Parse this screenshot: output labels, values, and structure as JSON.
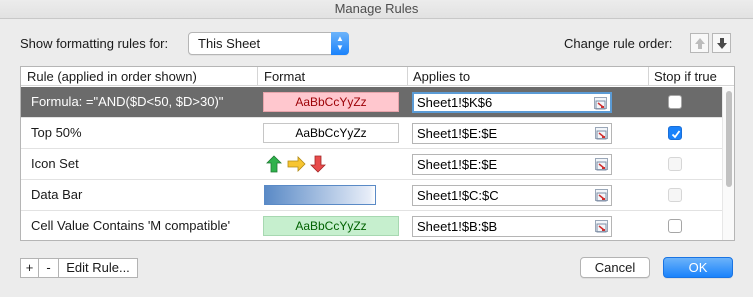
{
  "window": {
    "title": "Manage Rules"
  },
  "header": {
    "show_label": "Show formatting rules for:",
    "scope_value": "This Sheet",
    "order_label": "Change rule order:"
  },
  "table": {
    "columns": [
      "Rule (applied in order shown)",
      "Format",
      "Applies to",
      "Stop if true"
    ],
    "rows": [
      {
        "rule": "Formula: =\"AND($D<50, $D>30)\"",
        "format_type": "text-pink",
        "format_sample": "AaBbCcYyZz",
        "applies_to": "Sheet1!$K$6",
        "stop_if_true": false,
        "stop_enabled": true,
        "selected": true
      },
      {
        "rule": "Top 50%",
        "format_type": "text-plain",
        "format_sample": "AaBbCcYyZz",
        "applies_to": "Sheet1!$E:$E",
        "stop_if_true": true,
        "stop_enabled": true,
        "selected": false
      },
      {
        "rule": "Icon Set",
        "format_type": "icon-set",
        "format_icons": [
          "arrow-up-green-icon",
          "arrow-right-yellow-icon",
          "arrow-down-red-icon"
        ],
        "applies_to": "Sheet1!$E:$E",
        "stop_if_true": false,
        "stop_enabled": false,
        "selected": false
      },
      {
        "rule": "Data Bar",
        "format_type": "data-bar",
        "applies_to": "Sheet1!$C:$C",
        "stop_if_true": false,
        "stop_enabled": false,
        "selected": false
      },
      {
        "rule": "Cell Value Contains 'M compatible'",
        "format_type": "text-green",
        "format_sample": "AaBbCcYyZz",
        "applies_to": "Sheet1!$B:$B",
        "stop_if_true": false,
        "stop_enabled": true,
        "selected": false
      }
    ]
  },
  "footer": {
    "add_label": "+",
    "remove_label": "-",
    "edit_label": "Edit Rule...",
    "cancel_label": "Cancel",
    "ok_label": "OK"
  },
  "colors": {
    "selection": "#6b6b6b",
    "accent": "#1a82fb",
    "pink_fill": "#ffc7ce",
    "pink_text": "#9c0006",
    "green_fill": "#c6efce",
    "green_text": "#006100",
    "data_bar": "#5a8ac6"
  }
}
